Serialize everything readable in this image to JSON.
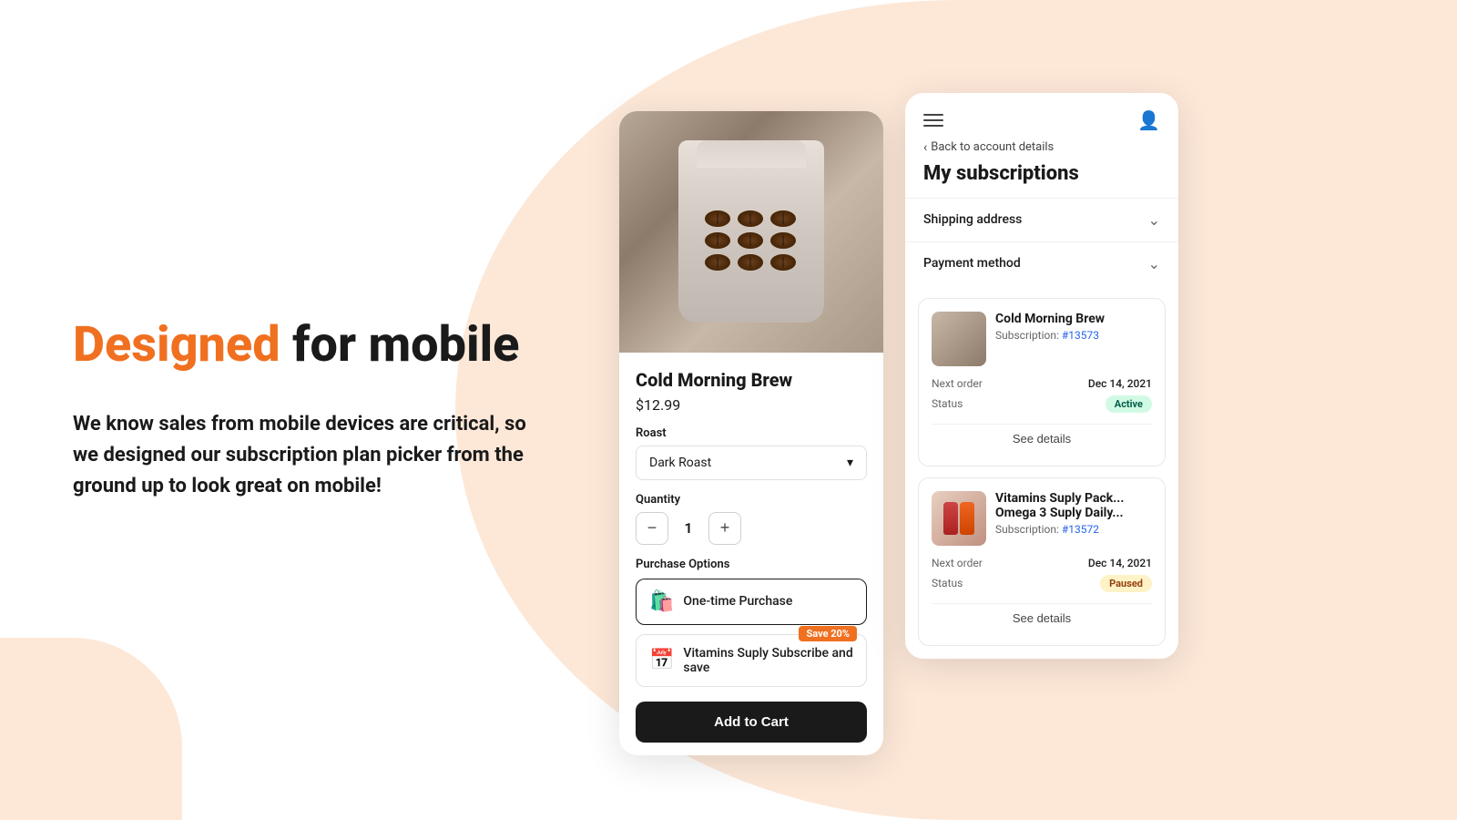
{
  "page": {
    "headline_highlight": "Designed",
    "headline_rest": " for mobile",
    "subtext": "We know sales from mobile devices are critical, so we designed our subscription plan picker from the ground up to look great on mobile!",
    "colors": {
      "accent": "#f07020",
      "dark": "#1a1a1a",
      "bg_blob": "#fde8d8"
    }
  },
  "product_panel": {
    "product_name": "Cold Morning Brew",
    "product_price": "$12.99",
    "roast_label": "Roast",
    "roast_value": "Dark Roast",
    "quantity_label": "Quantity",
    "quantity_value": "1",
    "purchase_options_label": "Purchase Options",
    "options": [
      {
        "id": "one-time",
        "text": "One-time Purchase",
        "icon": "🛍️",
        "badge": null
      },
      {
        "id": "subscribe",
        "text": "Vitamins Suply Subscribe and save",
        "icon": "📅",
        "badge": "Save 20%"
      }
    ],
    "add_to_cart_label": "Add to Cart",
    "decrement_label": "−",
    "increment_label": "+"
  },
  "subscriptions_panel": {
    "back_link": "Back to account details",
    "title": "My subscriptions",
    "shipping_address_label": "Shipping address",
    "payment_method_label": "Payment method",
    "subscriptions": [
      {
        "id": "sub1",
        "product_name": "Cold Morning Brew",
        "subscription_text": "Subscription: ",
        "subscription_number": "#13573",
        "next_order_label": "Next order",
        "next_order_value": "Dec 14, 2021",
        "status_label": "Status",
        "status_value": "Active",
        "status_type": "active",
        "see_details_label": "See details",
        "image_type": "coffee"
      },
      {
        "id": "sub2",
        "product_name": "Vitamins Suply Pack... Omega 3 Suply Daily...",
        "subscription_text": "Subscription: ",
        "subscription_number": "#13572",
        "next_order_label": "Next order",
        "next_order_value": "Dec 14, 2021",
        "status_label": "Status",
        "status_value": "Paused",
        "status_type": "paused",
        "see_details_label": "See details",
        "image_type": "vitamins"
      }
    ]
  }
}
